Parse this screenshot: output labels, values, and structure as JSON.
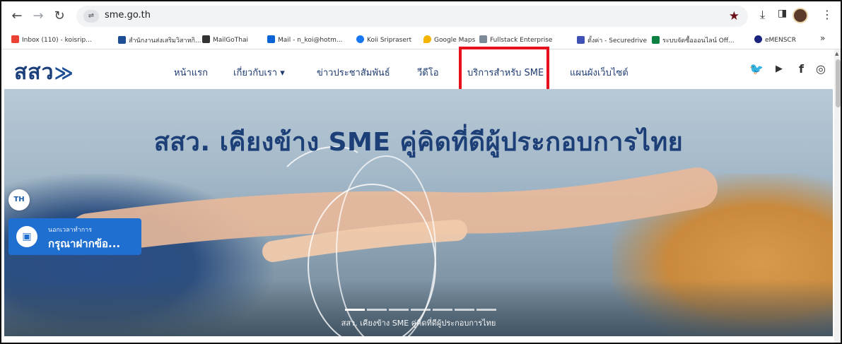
{
  "browser": {
    "url": "sme.go.th",
    "bookmarks": [
      {
        "label": "Inbox (110) - koisrip...",
        "color": "#ea4335"
      },
      {
        "label": "สำนักงานส่งเสริมวิสาหกิ...",
        "color": "#1d4e96"
      },
      {
        "label": "MailGoThai",
        "color": "#333333"
      },
      {
        "label": "Mail - n_koi@hotm...",
        "color": "#0a64d8"
      },
      {
        "label": "Koii Sriprasert",
        "color": "#1877f2"
      },
      {
        "label": "Google Maps",
        "color": "#f4b400"
      },
      {
        "label": "Fullstack Enterprise",
        "color": "#7d8b99"
      },
      {
        "label": "ตั้งค่า - Securedrive",
        "color": "#3f51b5"
      },
      {
        "label": "ระบบจัดซื้อออนไลน์ Off...",
        "color": "#0b8043"
      },
      {
        "label": "eMENSCR",
        "color": "#1a237e"
      }
    ],
    "more_bookmarks": "»"
  },
  "site": {
    "logo": "สสว",
    "logo_arrow": "≫",
    "menu": [
      {
        "label": "หน้าแรก"
      },
      {
        "label": "เกี่ยวกับเรา ▾"
      },
      {
        "label": "ข่าวประชาสัมพันธ์"
      },
      {
        "label": "วีดีโอ"
      },
      {
        "label": "บริการสำหรับ SME"
      },
      {
        "label": "แผนผังเว็บไซต์"
      }
    ],
    "highlight_color": "#e8101c"
  },
  "hero": {
    "title": "สสว. เคียงข้าง SME คู่คิดที่ดีผู้ประกอบการไทย",
    "caption": "สสว. เคียงข้าง SME คู่คิดที่ดีผู้ประกอบการไทย",
    "slide_count": 7,
    "active_slide": 1
  },
  "chat": {
    "language": "TH",
    "status": "นอกเวลาทำการ",
    "message": "กรุณาฝากข้อ..."
  }
}
